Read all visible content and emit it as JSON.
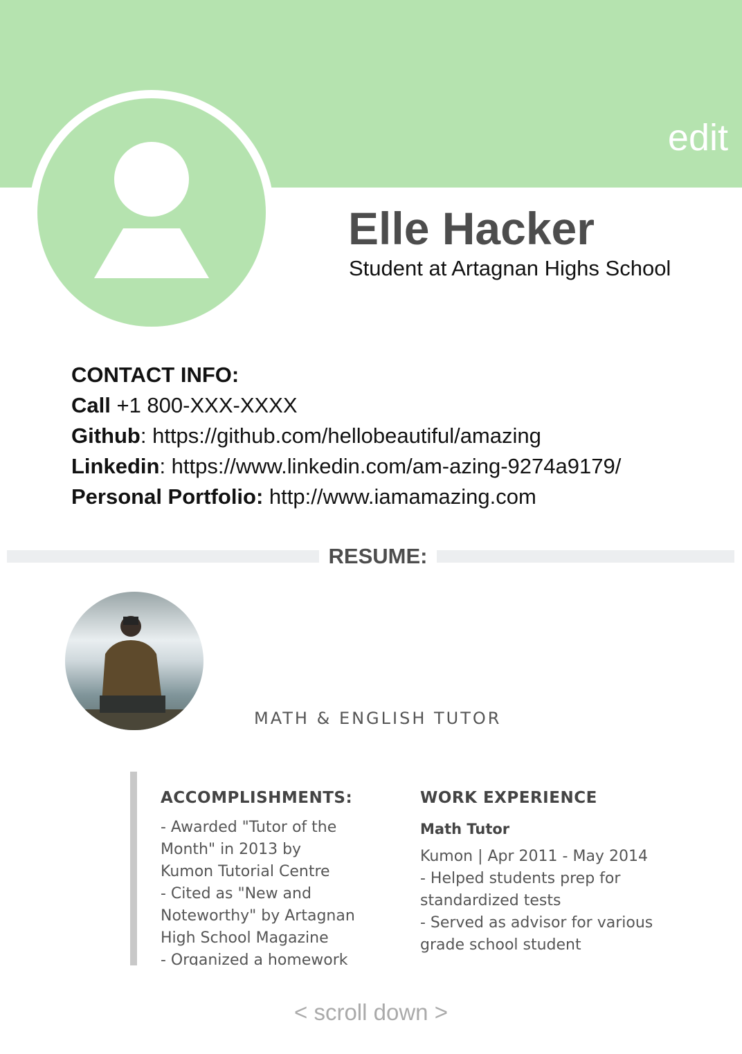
{
  "header": {
    "edit_label": "edit",
    "accent_color": "#b5e3af"
  },
  "profile": {
    "name": "Elle Hacker",
    "subtitle": "Student at Artagnan Highs School"
  },
  "contact": {
    "heading": "CONTACT INFO:",
    "call_label": "Call",
    "call_value": " +1 800-XXX-XXXX",
    "github_label": "Github",
    "github_value": ": https://github.com/hellobeautiful/amazing",
    "linkedin_label": "Linkedin",
    "linkedin_value": ": https://www.linkedin.com/am-azing-9274a9179/",
    "portfolio_label": "Personal Portfolio:",
    "portfolio_value": " http://www.iamamazing.com"
  },
  "resume": {
    "heading": "RESUME:",
    "job_title": "MATH & ENGLISH TUTOR",
    "accomplishments": {
      "heading": "ACCOMPLISHMENTS:",
      "lines": [
        "- Awarded \"Tutor of the",
        "Month\" in 2013 by",
        "Kumon Tutorial Centre",
        "- Cited as \"New and",
        "Noteworthy\" by Artagnan",
        "High School Magazine",
        "- Organized a homework"
      ]
    },
    "work_experience": {
      "heading": "WORK EXPERIENCE",
      "role": "Math Tutor",
      "lines": [
        "Kumon | Apr 2011 - May 2014",
        "- Helped students prep for",
        "standardized tests",
        "- Served as advisor for various",
        "grade school student"
      ]
    }
  },
  "footer": {
    "scroll_hint": "< scroll down >"
  }
}
